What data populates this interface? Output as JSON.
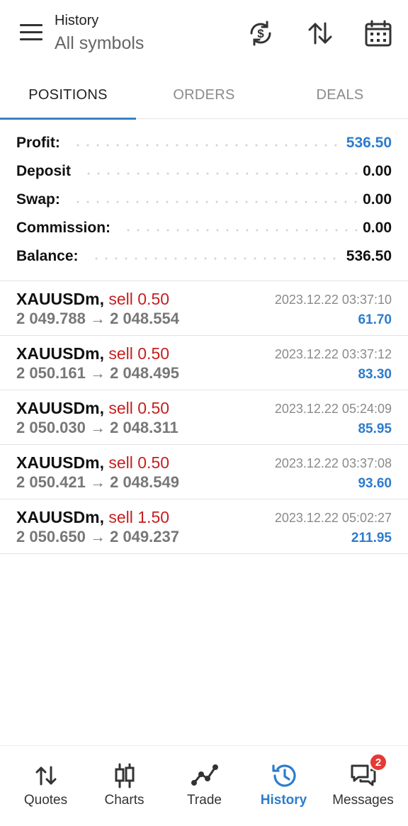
{
  "header": {
    "title": "History",
    "subtitle": "All symbols",
    "icons": [
      "menu-icon",
      "currency-exchange-icon",
      "sort-icon",
      "calendar-icon"
    ]
  },
  "tabs": [
    {
      "label": "POSITIONS",
      "active": true
    },
    {
      "label": "ORDERS",
      "active": false
    },
    {
      "label": "DEALS",
      "active": false
    }
  ],
  "summary": [
    {
      "label": "Profit:",
      "value": "536.50"
    },
    {
      "label": "Deposit",
      "value": "0.00"
    },
    {
      "label": "Swap:",
      "value": "0.00"
    },
    {
      "label": "Commission:",
      "value": "0.00"
    },
    {
      "label": "Balance:",
      "value": "536.50"
    }
  ],
  "positions": [
    {
      "symbol": "XAUUSDm,",
      "side": "sell 0.50",
      "prices": "2 049.788 → 2 048.554",
      "time": "2023.12.22 03:37:10",
      "profit": "61.70"
    },
    {
      "symbol": "XAUUSDm,",
      "side": "sell 0.50",
      "prices": "2 050.161 → 2 048.495",
      "time": "2023.12.22 03:37:12",
      "profit": "83.30"
    },
    {
      "symbol": "XAUUSDm,",
      "side": "sell 0.50",
      "prices": "2 050.030 → 2 048.311",
      "time": "2023.12.22 05:24:09",
      "profit": "85.95"
    },
    {
      "symbol": "XAUUSDm,",
      "side": "sell 0.50",
      "prices": "2 050.421 → 2 048.549",
      "time": "2023.12.22 03:37:08",
      "profit": "93.60"
    },
    {
      "symbol": "XAUUSDm,",
      "side": "sell 1.50",
      "prices": "2 050.650 → 2 049.237",
      "time": "2023.12.22 05:02:27",
      "profit": "211.95"
    }
  ],
  "nav": [
    {
      "label": "Quotes",
      "icon": "quotes-icon",
      "active": false
    },
    {
      "label": "Charts",
      "icon": "candlestick-icon",
      "active": false
    },
    {
      "label": "Trade",
      "icon": "trade-icon",
      "active": false
    },
    {
      "label": "History",
      "icon": "history-icon",
      "active": true
    },
    {
      "label": "Messages",
      "icon": "messages-icon",
      "active": false,
      "badge": "2"
    }
  ],
  "colors": {
    "accent": "#2d7ccc",
    "sell": "#c81e1e",
    "badge": "#e53935"
  }
}
